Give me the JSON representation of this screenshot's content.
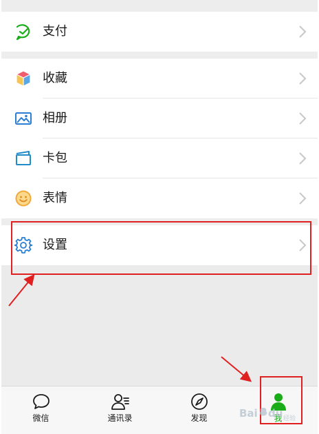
{
  "menu": {
    "pay": {
      "label": "支付",
      "icon": "wallet-check-icon"
    },
    "favorites": {
      "label": "收藏",
      "icon": "cube-icon"
    },
    "album": {
      "label": "相册",
      "icon": "image-icon"
    },
    "cards": {
      "label": "卡包",
      "icon": "card-wallet-icon"
    },
    "stickers": {
      "label": "表情",
      "icon": "smiley-icon"
    },
    "settings": {
      "label": "设置",
      "icon": "gear-icon"
    }
  },
  "tabbar": {
    "tabs": [
      {
        "label": "微信",
        "icon": "chat-bubble-icon",
        "active": false
      },
      {
        "label": "通讯录",
        "icon": "contacts-icon",
        "active": false
      },
      {
        "label": "发现",
        "icon": "compass-icon",
        "active": false
      },
      {
        "label": "我",
        "icon": "person-icon",
        "active": true
      }
    ]
  },
  "watermark": {
    "text": "Bai du 经验"
  },
  "colors": {
    "accent": "#1aad19",
    "annotation": "#e02020",
    "background": "#ededed",
    "row": "#ffffff",
    "tabbar": "#f7f7f7"
  }
}
